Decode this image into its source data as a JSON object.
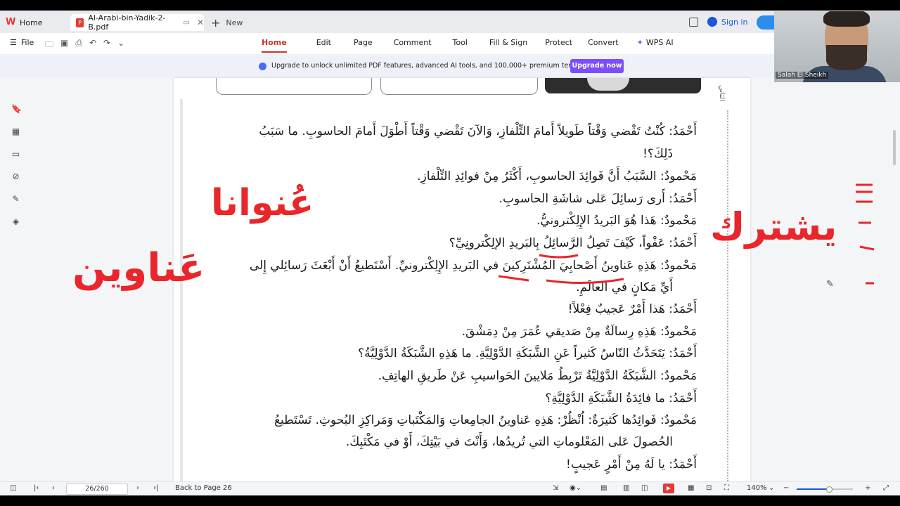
{
  "tabs": {
    "home_label": "Home",
    "doc_label": "Al-Arabi-bin-Yadik-2-B.pdf",
    "new_label": "New"
  },
  "account": {
    "signin_label": "Sign in"
  },
  "menu": {
    "file_label": "File",
    "items": [
      "Home",
      "Edit",
      "Page",
      "Comment",
      "Tool",
      "Fill & Sign",
      "Protect",
      "Convert",
      "WPS AI"
    ],
    "active": "Home"
  },
  "banner": {
    "text": "Upgrade to unlock unlimited PDF features, advanced AI tools, and 100,000+ premium templates.",
    "button": "Upgrade now"
  },
  "document": {
    "side_tab": "الثاني",
    "lines": [
      "أَحْمَدُ: كُنْتُ  تَقْضي وَقْتاً طَويلاً أَمامَ التِّلْفازِ، وَالآنَ تَقْضي وَقْتاً أَطْوَلَ أَمامَ الحاسوبِ. ما سَبَبُ",
      "ذَلِكَ؟!",
      "مَحْمودٌ: السَّبَبُ أَنَّ فَوائِدَ الحاسوبِ، أَكْثَرُ مِنْ فوائِدِ التِّلْفازِ.",
      "أَحْمَدُ: أَرى رَسائِلَ عَلى شاشَةِ الحاسوبِ.",
      "مَحْمودٌ: هَذا هُوَ البَريدُ الإِلِكْترونيُّ.",
      "أَحْمَدُ: عَفْواً، كَيْفَ تَصِلُ الرَّسائِلُ بِالبَريدِ الإلِكْترونِيِّ؟",
      "مَحْمودٌ: هَذِهِ عَناوينُ أَصْحابِيَ المُشْتَرِكينَ في البَريدِ الإِلِكْترونيِّ. أَسْتَطيعُ أَنْ أَبْعَثَ رَسائِلي إِلى",
      "أَيِّ مَكانٍ في العالَمِ.",
      "أَحْمَدُ: هَذا أَمْرٌ عَجيبٌ فِعْلاً!",
      "مَحْمودٌ: هَذِهِ رِسالَةٌ مِنْ صَديقي عُمَرَ مِنْ دِمَشْقَ.",
      "أَحْمَدُ: يَتَحَدَّثُ النّاسُ كَثيراً عَنِ الشَّبَكَةِ الدَّوْلِيَّةِ. ما هَذِهِ الشَّبَكَةُ الدَّوْلِيَّةُ؟",
      "مَحْمودٌ: الشَّبَكَةُ الدَّوْلِيَّةُ تَرْبِطُ مَلايينَ الحَواسيبِ عَنْ طَريقِ الهاتِفِ.",
      "أَحْمَدُ: ما فائِدَةُ الشَّبَكَةِ الدَّوْلِيَّةِ؟",
      "مَحْمودٌ: فَوائِدُها كَثيرَةٌ: اُنْظُرْ: هَذِهِ عَناوينُ الجامِعاتِ وَالمَكْتَباتِ وَمَراكِزِ البُحوثِ. تَسْتَطيعُ",
      "الحُصولَ عَلى المَعْلوماتِ التي تُريدُها، وَأَنْتَ في بَيْتِكَ، أَوْ في مَكْتَبِكَ.",
      "أَحْمَدُ: يا لَهُ مِنْ أَمْرٍ عَجيبٍ!"
    ],
    "annotations": {
      "word1": "عُنوانا",
      "word2": "عَناوين",
      "word3": "يشترك"
    }
  },
  "statusbar": {
    "page_indicator": "26/260",
    "back_label": "Back to Page 26",
    "zoom": "140%"
  },
  "webcam": {
    "name": "Salah El Sheikh"
  },
  "colors": {
    "accent": "#c0392b",
    "upgrade": "#7c4dff",
    "ink": "#e8262b"
  }
}
